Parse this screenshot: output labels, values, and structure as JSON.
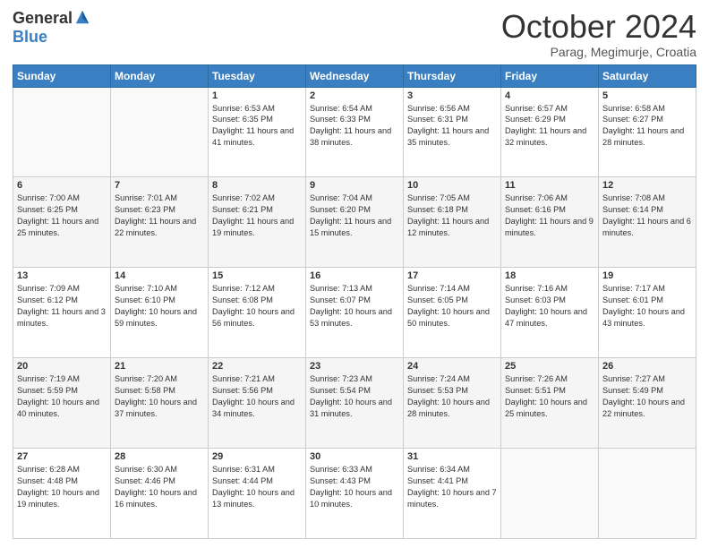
{
  "logo": {
    "general": "General",
    "blue": "Blue"
  },
  "header": {
    "month": "October 2024",
    "location": "Parag, Megimurje, Croatia"
  },
  "weekdays": [
    "Sunday",
    "Monday",
    "Tuesday",
    "Wednesday",
    "Thursday",
    "Friday",
    "Saturday"
  ],
  "weeks": [
    [
      {
        "day": "",
        "sunrise": "",
        "sunset": "",
        "daylight": ""
      },
      {
        "day": "",
        "sunrise": "",
        "sunset": "",
        "daylight": ""
      },
      {
        "day": "1",
        "sunrise": "Sunrise: 6:53 AM",
        "sunset": "Sunset: 6:35 PM",
        "daylight": "Daylight: 11 hours and 41 minutes."
      },
      {
        "day": "2",
        "sunrise": "Sunrise: 6:54 AM",
        "sunset": "Sunset: 6:33 PM",
        "daylight": "Daylight: 11 hours and 38 minutes."
      },
      {
        "day": "3",
        "sunrise": "Sunrise: 6:56 AM",
        "sunset": "Sunset: 6:31 PM",
        "daylight": "Daylight: 11 hours and 35 minutes."
      },
      {
        "day": "4",
        "sunrise": "Sunrise: 6:57 AM",
        "sunset": "Sunset: 6:29 PM",
        "daylight": "Daylight: 11 hours and 32 minutes."
      },
      {
        "day": "5",
        "sunrise": "Sunrise: 6:58 AM",
        "sunset": "Sunset: 6:27 PM",
        "daylight": "Daylight: 11 hours and 28 minutes."
      }
    ],
    [
      {
        "day": "6",
        "sunrise": "Sunrise: 7:00 AM",
        "sunset": "Sunset: 6:25 PM",
        "daylight": "Daylight: 11 hours and 25 minutes."
      },
      {
        "day": "7",
        "sunrise": "Sunrise: 7:01 AM",
        "sunset": "Sunset: 6:23 PM",
        "daylight": "Daylight: 11 hours and 22 minutes."
      },
      {
        "day": "8",
        "sunrise": "Sunrise: 7:02 AM",
        "sunset": "Sunset: 6:21 PM",
        "daylight": "Daylight: 11 hours and 19 minutes."
      },
      {
        "day": "9",
        "sunrise": "Sunrise: 7:04 AM",
        "sunset": "Sunset: 6:20 PM",
        "daylight": "Daylight: 11 hours and 15 minutes."
      },
      {
        "day": "10",
        "sunrise": "Sunrise: 7:05 AM",
        "sunset": "Sunset: 6:18 PM",
        "daylight": "Daylight: 11 hours and 12 minutes."
      },
      {
        "day": "11",
        "sunrise": "Sunrise: 7:06 AM",
        "sunset": "Sunset: 6:16 PM",
        "daylight": "Daylight: 11 hours and 9 minutes."
      },
      {
        "day": "12",
        "sunrise": "Sunrise: 7:08 AM",
        "sunset": "Sunset: 6:14 PM",
        "daylight": "Daylight: 11 hours and 6 minutes."
      }
    ],
    [
      {
        "day": "13",
        "sunrise": "Sunrise: 7:09 AM",
        "sunset": "Sunset: 6:12 PM",
        "daylight": "Daylight: 11 hours and 3 minutes."
      },
      {
        "day": "14",
        "sunrise": "Sunrise: 7:10 AM",
        "sunset": "Sunset: 6:10 PM",
        "daylight": "Daylight: 10 hours and 59 minutes."
      },
      {
        "day": "15",
        "sunrise": "Sunrise: 7:12 AM",
        "sunset": "Sunset: 6:08 PM",
        "daylight": "Daylight: 10 hours and 56 minutes."
      },
      {
        "day": "16",
        "sunrise": "Sunrise: 7:13 AM",
        "sunset": "Sunset: 6:07 PM",
        "daylight": "Daylight: 10 hours and 53 minutes."
      },
      {
        "day": "17",
        "sunrise": "Sunrise: 7:14 AM",
        "sunset": "Sunset: 6:05 PM",
        "daylight": "Daylight: 10 hours and 50 minutes."
      },
      {
        "day": "18",
        "sunrise": "Sunrise: 7:16 AM",
        "sunset": "Sunset: 6:03 PM",
        "daylight": "Daylight: 10 hours and 47 minutes."
      },
      {
        "day": "19",
        "sunrise": "Sunrise: 7:17 AM",
        "sunset": "Sunset: 6:01 PM",
        "daylight": "Daylight: 10 hours and 43 minutes."
      }
    ],
    [
      {
        "day": "20",
        "sunrise": "Sunrise: 7:19 AM",
        "sunset": "Sunset: 5:59 PM",
        "daylight": "Daylight: 10 hours and 40 minutes."
      },
      {
        "day": "21",
        "sunrise": "Sunrise: 7:20 AM",
        "sunset": "Sunset: 5:58 PM",
        "daylight": "Daylight: 10 hours and 37 minutes."
      },
      {
        "day": "22",
        "sunrise": "Sunrise: 7:21 AM",
        "sunset": "Sunset: 5:56 PM",
        "daylight": "Daylight: 10 hours and 34 minutes."
      },
      {
        "day": "23",
        "sunrise": "Sunrise: 7:23 AM",
        "sunset": "Sunset: 5:54 PM",
        "daylight": "Daylight: 10 hours and 31 minutes."
      },
      {
        "day": "24",
        "sunrise": "Sunrise: 7:24 AM",
        "sunset": "Sunset: 5:53 PM",
        "daylight": "Daylight: 10 hours and 28 minutes."
      },
      {
        "day": "25",
        "sunrise": "Sunrise: 7:26 AM",
        "sunset": "Sunset: 5:51 PM",
        "daylight": "Daylight: 10 hours and 25 minutes."
      },
      {
        "day": "26",
        "sunrise": "Sunrise: 7:27 AM",
        "sunset": "Sunset: 5:49 PM",
        "daylight": "Daylight: 10 hours and 22 minutes."
      }
    ],
    [
      {
        "day": "27",
        "sunrise": "Sunrise: 6:28 AM",
        "sunset": "Sunset: 4:48 PM",
        "daylight": "Daylight: 10 hours and 19 minutes."
      },
      {
        "day": "28",
        "sunrise": "Sunrise: 6:30 AM",
        "sunset": "Sunset: 4:46 PM",
        "daylight": "Daylight: 10 hours and 16 minutes."
      },
      {
        "day": "29",
        "sunrise": "Sunrise: 6:31 AM",
        "sunset": "Sunset: 4:44 PM",
        "daylight": "Daylight: 10 hours and 13 minutes."
      },
      {
        "day": "30",
        "sunrise": "Sunrise: 6:33 AM",
        "sunset": "Sunset: 4:43 PM",
        "daylight": "Daylight: 10 hours and 10 minutes."
      },
      {
        "day": "31",
        "sunrise": "Sunrise: 6:34 AM",
        "sunset": "Sunset: 4:41 PM",
        "daylight": "Daylight: 10 hours and 7 minutes."
      },
      {
        "day": "",
        "sunrise": "",
        "sunset": "",
        "daylight": ""
      },
      {
        "day": "",
        "sunrise": "",
        "sunset": "",
        "daylight": ""
      }
    ]
  ]
}
